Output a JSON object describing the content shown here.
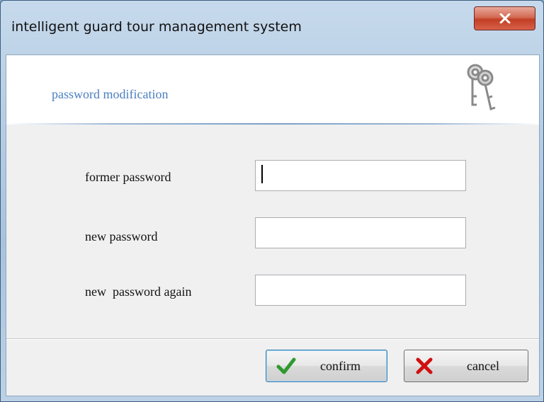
{
  "window": {
    "title": "intelligent guard tour management system",
    "close_label": "X"
  },
  "header": {
    "title": "password modification",
    "icon": "keys-icon"
  },
  "form": {
    "fields": [
      {
        "label": "former password",
        "value": ""
      },
      {
        "label": "new password",
        "value": ""
      },
      {
        "label": "new  password again",
        "value": ""
      }
    ]
  },
  "buttons": {
    "confirm_label": "confirm",
    "cancel_label": "cancel"
  },
  "colors": {
    "accent_title": "#4a7fc0",
    "confirm_check": "#2e9a2e",
    "cancel_x": "#d01010"
  }
}
